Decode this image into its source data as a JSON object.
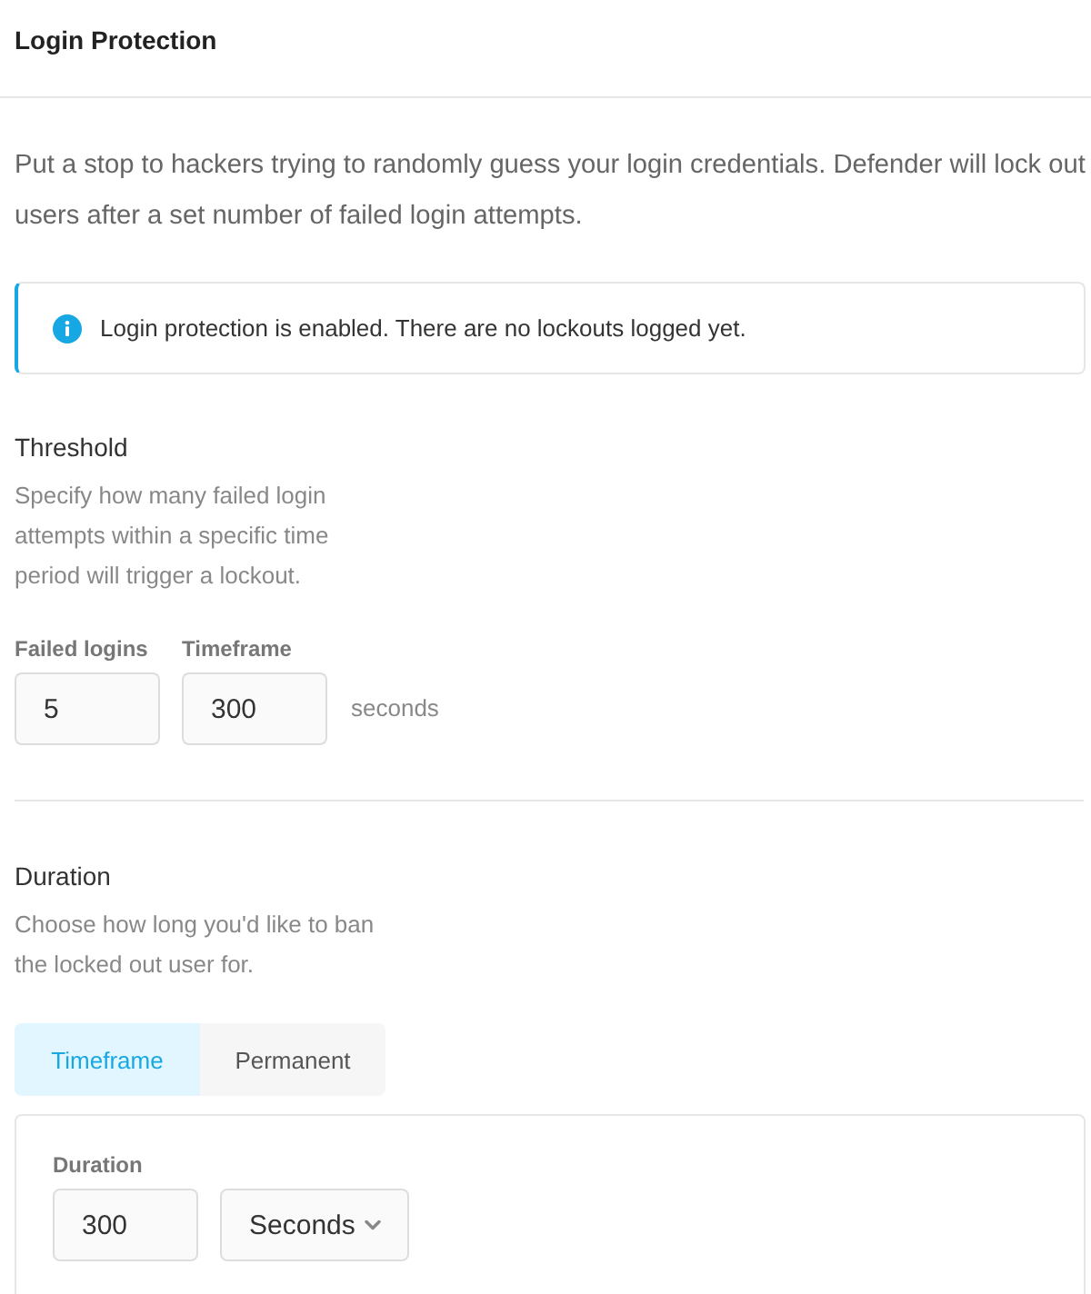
{
  "header": {
    "title": "Login Protection"
  },
  "intro": "Put a stop to hackers trying to randomly guess your login credentials. Defender will lock out users after a set number of failed login attempts.",
  "notice": {
    "kind": "info",
    "text": "Login protection is enabled. There are no lockouts logged yet."
  },
  "threshold": {
    "title": "Threshold",
    "description": "Specify how many failed login attempts within a specific time period will trigger a lockout.",
    "fields": [
      {
        "label": "Failed logins",
        "value": "5"
      },
      {
        "label": "Timeframe",
        "value": "300"
      }
    ],
    "unit": "seconds"
  },
  "duration": {
    "title": "Duration",
    "description": "Choose how long you'd like to ban the locked out user for.",
    "tabs": [
      {
        "label": "Timeframe",
        "selected": true
      },
      {
        "label": "Permanent",
        "selected": false
      }
    ],
    "panel": {
      "label": "Duration",
      "value": "300",
      "unit": "Seconds"
    }
  }
}
